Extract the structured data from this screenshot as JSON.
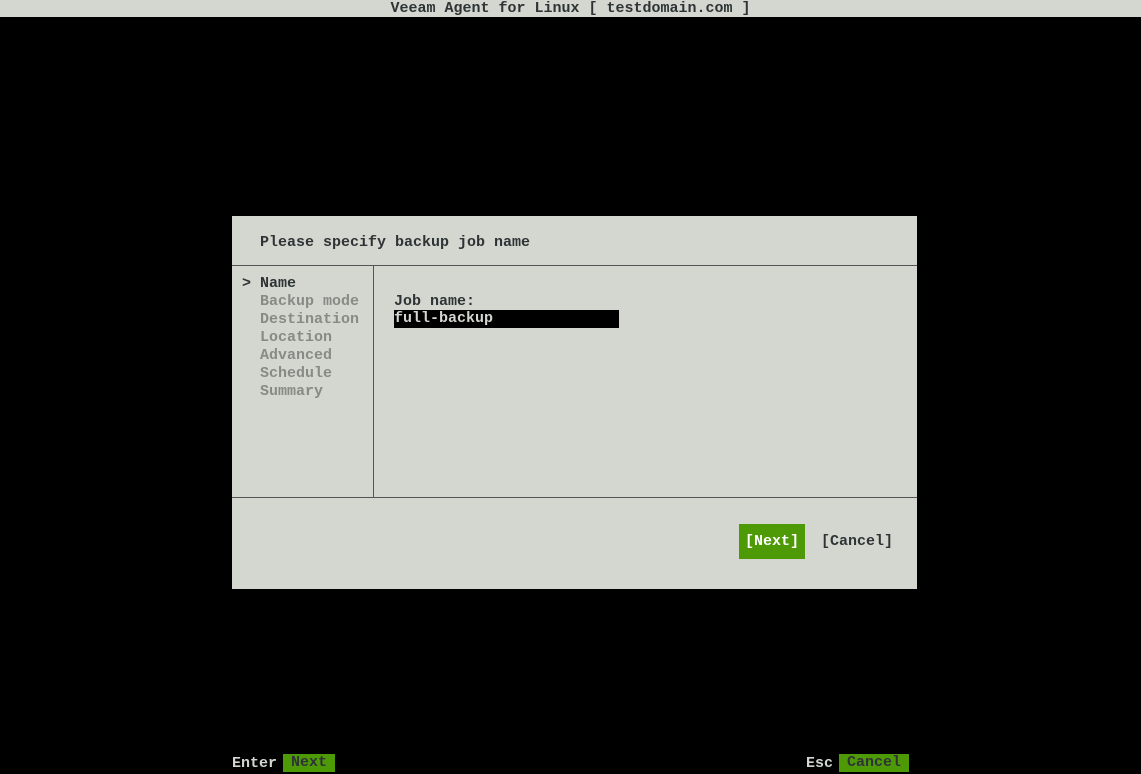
{
  "header": {
    "title": "Veeam Agent for Linux   [ testdomain.com ]"
  },
  "dialog": {
    "title": "Please specify backup job name",
    "sidebar": {
      "items": [
        {
          "label": "Name",
          "active": true
        },
        {
          "label": "Backup mode",
          "active": false
        },
        {
          "label": "Destination",
          "active": false
        },
        {
          "label": "Location",
          "active": false
        },
        {
          "label": "Advanced",
          "active": false
        },
        {
          "label": "Schedule",
          "active": false
        },
        {
          "label": "Summary",
          "active": false
        }
      ]
    },
    "content": {
      "field_label": "Job name:",
      "field_value": "full-backup"
    },
    "buttons": {
      "next": "[Next]",
      "cancel": "[Cancel]"
    }
  },
  "footer": {
    "left_key": "Enter",
    "left_action": "Next",
    "right_key": "Esc",
    "right_action": "Cancel"
  }
}
